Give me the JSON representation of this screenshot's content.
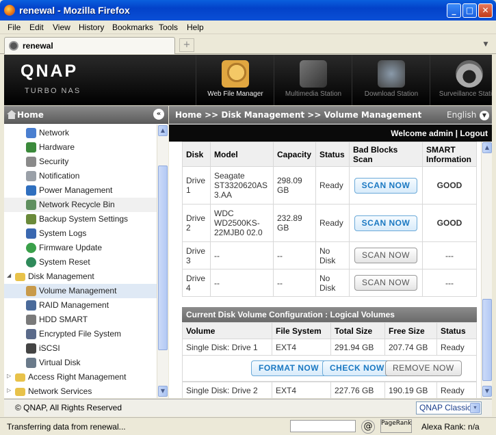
{
  "window": {
    "title": "renewal - Mozilla Firefox",
    "min": "_",
    "max": "□",
    "close": "✕"
  },
  "menu": [
    "File",
    "Edit",
    "View",
    "History",
    "Bookmarks",
    "Tools",
    "Help"
  ],
  "tab": {
    "label": "renewal",
    "new_tab": "+"
  },
  "header": {
    "logo": "QNAP",
    "subtitle": "Turbo NAS",
    "apps": [
      "Web File Manager",
      "Multimedia Station",
      "Download Station",
      "Surveillance Station"
    ]
  },
  "sidebar": {
    "title": "Home",
    "collapse": "«",
    "items": [
      {
        "label": "Network",
        "icon": "network-icon",
        "color": "#4a7fd0"
      },
      {
        "label": "Hardware",
        "icon": "hardware-icon",
        "color": "#3b8a3b"
      },
      {
        "label": "Security",
        "icon": "security-icon",
        "color": "#8a8a8a"
      },
      {
        "label": "Notification",
        "icon": "notification-icon",
        "color": "#9aa0a8"
      },
      {
        "label": "Power Management",
        "icon": "power-icon",
        "color": "#2f6fbf"
      },
      {
        "label": "Network Recycle Bin",
        "icon": "recycle-bin-icon",
        "color": "#5f8f5f"
      },
      {
        "label": "Backup System Settings",
        "icon": "backup-icon",
        "color": "#6a8a3a"
      },
      {
        "label": "System Logs",
        "icon": "logs-icon",
        "color": "#3a68b0"
      },
      {
        "label": "Firmware Update",
        "icon": "firmware-icon",
        "color": "#3aa04a"
      },
      {
        "label": "System Reset",
        "icon": "reset-icon",
        "color": "#2f8a5a"
      },
      {
        "label": "Disk Management",
        "icon": "folder-icon",
        "color": "#e8c24a"
      },
      {
        "label": "Volume Management",
        "icon": "volume-icon",
        "color": "#c89a4a"
      },
      {
        "label": "RAID Management",
        "icon": "raid-icon",
        "color": "#4a6a9a"
      },
      {
        "label": "HDD SMART",
        "icon": "smart-icon",
        "color": "#7a7a7a"
      },
      {
        "label": "Encrypted File System",
        "icon": "encrypted-icon",
        "color": "#5a6a8a"
      },
      {
        "label": "iSCSI",
        "icon": "iscsi-icon",
        "color": "#444444"
      },
      {
        "label": "Virtual Disk",
        "icon": "virtual-disk-icon",
        "color": "#6a7a8a"
      },
      {
        "label": "Access Right Management",
        "icon": "folder-icon",
        "color": "#e8c24a"
      },
      {
        "label": "Network Services",
        "icon": "folder-icon",
        "color": "#e8c24a"
      }
    ]
  },
  "main": {
    "breadcrumb": "Home >> Disk Management >> Volume Management",
    "language": "English",
    "welcome": "Welcome admin | Logout",
    "disk_table": {
      "headers": [
        "Disk",
        "Model",
        "Capacity",
        "Status",
        "Bad Blocks Scan",
        "SMART Information"
      ],
      "rows": [
        {
          "disk": "Drive 1",
          "model": "Seagate ST3320620AS 3.AA",
          "capacity": "298.09 GB",
          "status": "Ready",
          "scan": "SCAN NOW",
          "smart": "GOOD"
        },
        {
          "disk": "Drive 2",
          "model": "WDC WD2500KS-22MJB0 02.0",
          "capacity": "232.89 GB",
          "status": "Ready",
          "scan": "SCAN NOW",
          "smart": "GOOD"
        },
        {
          "disk": "Drive 3",
          "model": "--",
          "capacity": "--",
          "status": "No Disk",
          "scan": "SCAN NOW",
          "smart": "---"
        },
        {
          "disk": "Drive 4",
          "model": "--",
          "capacity": "--",
          "status": "No Disk",
          "scan": "SCAN NOW",
          "smart": "---"
        }
      ]
    },
    "logical_volumes": {
      "title": "Current Disk Volume Configuration : Logical Volumes",
      "headers": [
        "Volume",
        "File System",
        "Total Size",
        "Free Size",
        "Status"
      ],
      "rows": [
        {
          "volume": "Single Disk: Drive 1",
          "fs": "EXT4",
          "total": "291.94 GB",
          "free": "207.74 GB",
          "status": "Ready"
        },
        {
          "volume": "Single Disk: Drive 2",
          "fs": "EXT4",
          "total": "227.76 GB",
          "free": "190.19 GB",
          "status": "Ready"
        }
      ],
      "actions": [
        "FORMAT NOW",
        "CHECK NOW",
        "REMOVE NOW"
      ]
    }
  },
  "footer": {
    "copyright": "© QNAP, All Rights Reserved",
    "theme": "QNAP Classic"
  },
  "statusbar": {
    "text": "Transferring data from renewal...",
    "pagerank": "PageRank",
    "alexa": "Alexa Rank: n/a",
    "at": "@"
  }
}
